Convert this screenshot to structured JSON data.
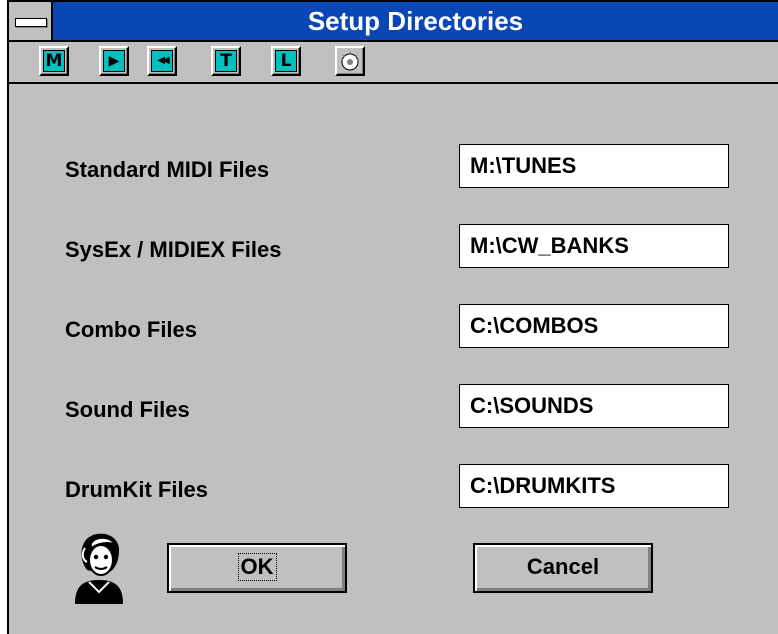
{
  "window": {
    "title": "Setup Directories"
  },
  "toolbar": {
    "buttons": [
      {
        "glyph": "M",
        "icon": "m-icon"
      },
      {
        "glyph": "▶",
        "icon": "play-icon"
      },
      {
        "glyph": "◀◀",
        "icon": "rewind-icon"
      },
      {
        "glyph": "T",
        "icon": "t-icon"
      },
      {
        "glyph": "L",
        "icon": "l-icon"
      },
      {
        "glyph": "",
        "icon": "stopwatch-icon"
      }
    ]
  },
  "fields": [
    {
      "label": "Standard MIDI Files",
      "value": "M:\\TUNES"
    },
    {
      "label": "SysEx / MIDIEX Files",
      "value": "M:\\CW_BANKS"
    },
    {
      "label": "Combo Files",
      "value": "C:\\COMBOS"
    },
    {
      "label": "Sound Files",
      "value": "C:\\SOUNDS"
    },
    {
      "label": "DrumKit Files",
      "value": "C:\\DRUMKITS"
    }
  ],
  "buttons": {
    "ok": "OK",
    "cancel": "Cancel"
  },
  "colors": {
    "titlebar": "#0a46b4",
    "toolbar_accent": "#00c0c0",
    "face": "#c0c0c0"
  }
}
